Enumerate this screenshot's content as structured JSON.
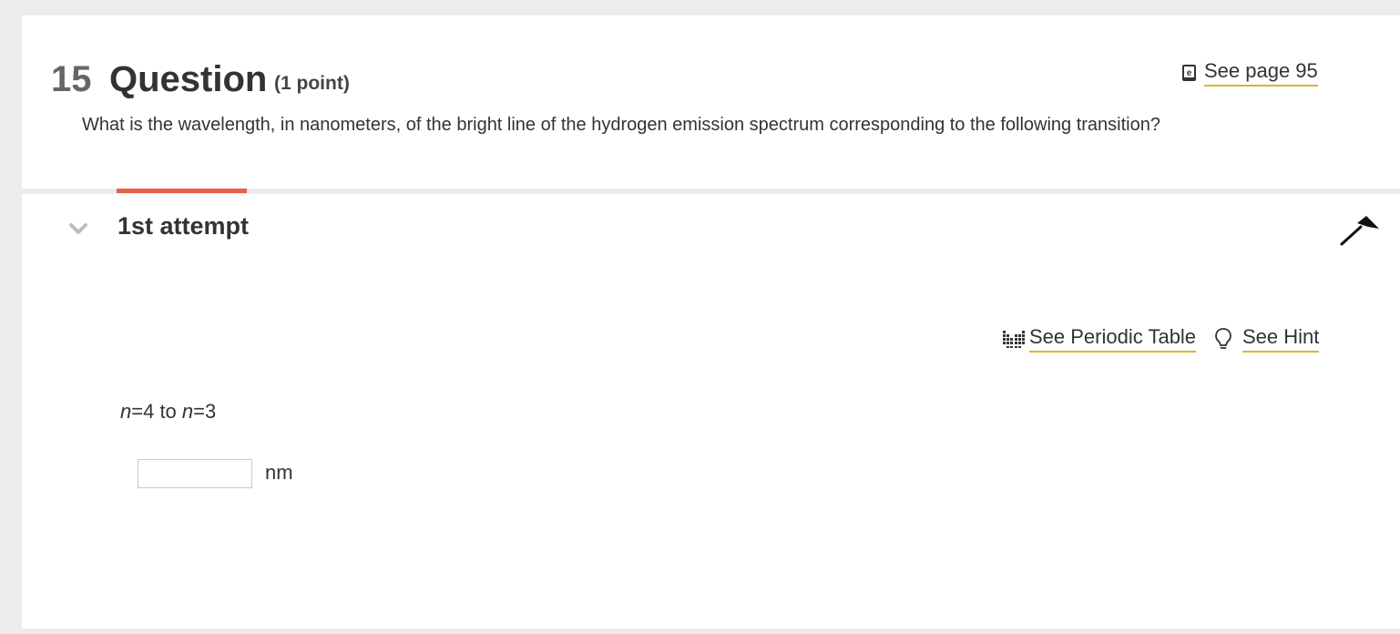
{
  "question": {
    "number": "15",
    "title": "Question",
    "points": "(1 point)",
    "text": "What is the wavelength, in nanometers, of the bright line of the hydrogen emission spectrum corresponding to the following transition?",
    "reference_link": "See page 95"
  },
  "attempt": {
    "title": "1st attempt",
    "periodic_table_link": "See Periodic Table",
    "hint_link": "See Hint",
    "transition": {
      "var1": "n",
      "eq1": "=4 to ",
      "var2": "n",
      "eq2": "=3"
    },
    "answer_value": "",
    "answer_placeholder": "",
    "unit": "nm"
  },
  "icons": {
    "reference": "ebook-icon",
    "collapse": "chevron-down-icon",
    "flag": "flag-icon",
    "periodic_table": "periodic-table-icon",
    "hint": "lightbulb-icon"
  },
  "colors": {
    "accent_bar": "#e8604c",
    "link_underline": "#e0b22c",
    "background": "#ececec",
    "card": "#ffffff"
  }
}
